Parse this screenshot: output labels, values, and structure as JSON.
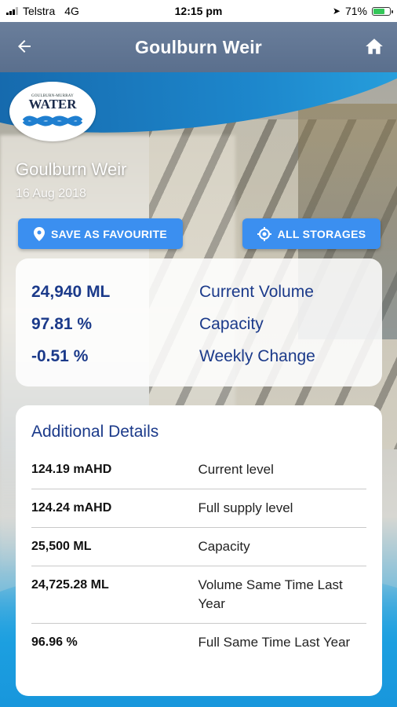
{
  "status_bar": {
    "carrier": "Telstra",
    "network": "4G",
    "time": "12:15 pm",
    "battery": "71%",
    "battery_level": 0.71
  },
  "header": {
    "title": "Goulburn Weir",
    "back_icon": "back-arrow-icon",
    "home_icon": "home-icon"
  },
  "logo": {
    "text": "WATER",
    "small_text": "GOULBURN-MURRAY"
  },
  "site": {
    "name": "Goulburn Weir",
    "date": "16 Aug 2018"
  },
  "actions": {
    "save_favourite": "SAVE AS FAVOURITE",
    "all_storages": "ALL STORAGES"
  },
  "summary": [
    {
      "value": "24,940 ML",
      "label": "Current Volume"
    },
    {
      "value": "97.81 %",
      "label": "Capacity"
    },
    {
      "value": "-0.51 %",
      "label": "Weekly Change"
    }
  ],
  "details": {
    "title": "Additional Details",
    "rows": [
      {
        "value": "124.19 mAHD",
        "label": "Current level"
      },
      {
        "value": "124.24 mAHD",
        "label": "Full supply level"
      },
      {
        "value": "25,500 ML",
        "label": "Capacity"
      },
      {
        "value": "24,725.28 ML",
        "label": "Volume Same Time Last Year"
      },
      {
        "value": "96.96 %",
        "label": "Full Same Time Last Year"
      }
    ]
  },
  "colors": {
    "accent": "#3b8ff0",
    "header": "#5e7390",
    "text_blue": "#1b3a8a"
  }
}
